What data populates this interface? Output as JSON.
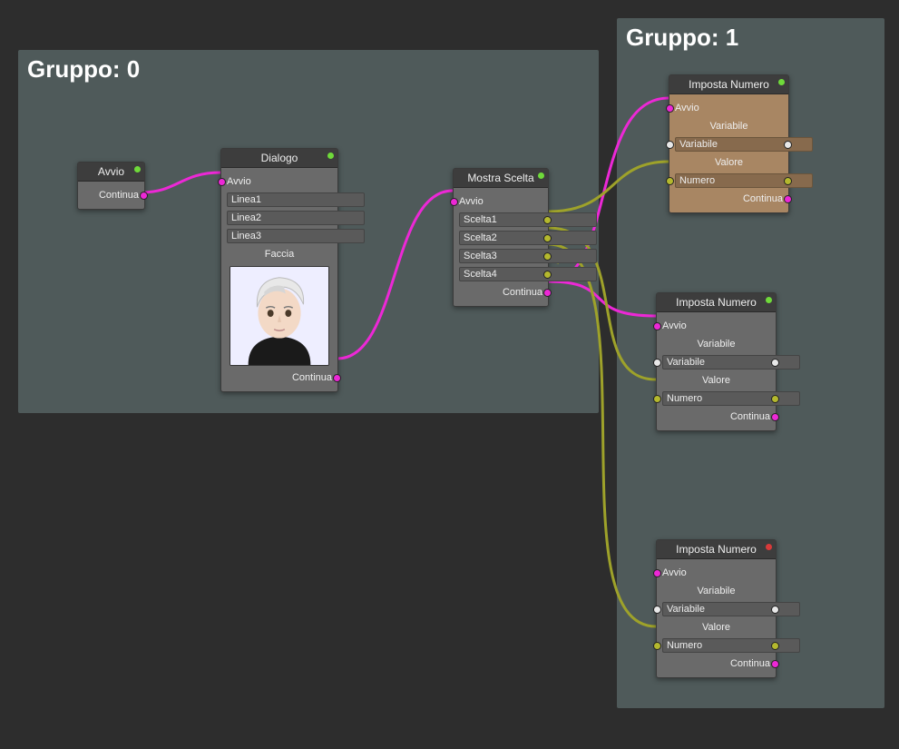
{
  "groups": {
    "g0": {
      "title": "Gruppo: 0"
    },
    "g1": {
      "title": "Gruppo: 1"
    }
  },
  "nodes": {
    "avvio": {
      "title": "Avvio",
      "continua": "Continua"
    },
    "dialogo": {
      "title": "Dialogo",
      "avvio": "Avvio",
      "linea1": "Linea1",
      "linea2": "Linea2",
      "linea3": "Linea3",
      "faccia": "Faccia",
      "continua": "Continua"
    },
    "mostra": {
      "title": "Mostra Scelta",
      "avvio": "Avvio",
      "scelta1": "Scelta1",
      "scelta2": "Scelta2",
      "scelta3": "Scelta3",
      "scelta4": "Scelta4",
      "continua": "Continua"
    },
    "imposta1": {
      "title": "Imposta Numero",
      "avvio": "Avvio",
      "variabile_lbl": "Variabile",
      "variabile": "Variabile",
      "valore_lbl": "Valore",
      "numero": "Numero",
      "continua": "Continua"
    },
    "imposta2": {
      "title": "Imposta Numero",
      "avvio": "Avvio",
      "variabile_lbl": "Variabile",
      "variabile": "Variabile",
      "valore_lbl": "Valore",
      "numero": "Numero",
      "continua": "Continua"
    },
    "imposta3": {
      "title": "Imposta Numero",
      "avvio": "Avvio",
      "variabile_lbl": "Variabile",
      "variabile": "Variabile",
      "valore_lbl": "Valore",
      "numero": "Numero",
      "continua": "Continua"
    }
  }
}
